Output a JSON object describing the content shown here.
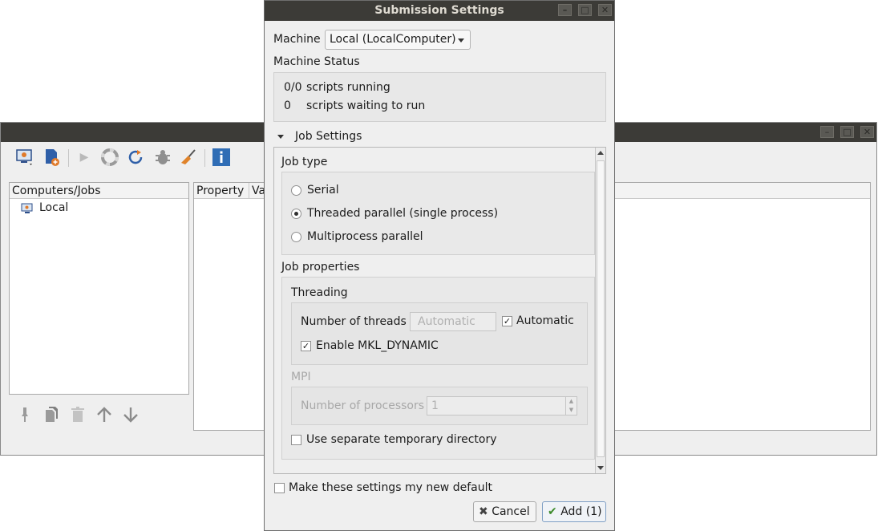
{
  "main_window": {
    "tree_header": "Computers/Jobs",
    "tree_items": [
      {
        "label": "Local",
        "icon": "computer-icon"
      }
    ],
    "properties_header": {
      "property": "Property",
      "value": "Va"
    },
    "toolbar_icons": [
      "computer-menu-icon",
      "add-job-icon",
      "run-icon",
      "lifebuoy-icon",
      "refresh-icon",
      "bug-icon",
      "clean-icon",
      "info-icon"
    ],
    "bottom_icons": [
      "pin-icon",
      "copy-icon",
      "trash-icon",
      "arrow-up-icon",
      "arrow-down-icon"
    ]
  },
  "dialog": {
    "title": "Submission Settings",
    "machine": {
      "label": "Machine",
      "value": "Local (LocalComputer)"
    },
    "machine_status": {
      "title": "Machine Status",
      "rows": [
        {
          "count": "0/0",
          "text": "scripts running"
        },
        {
          "count": "0",
          "text": "scripts waiting to run"
        }
      ]
    },
    "job_settings": {
      "title": "Job Settings"
    },
    "job_type": {
      "title": "Job type",
      "options": [
        {
          "label": "Serial",
          "selected": false
        },
        {
          "label": "Threaded parallel (single process)",
          "selected": true
        },
        {
          "label": "Multiprocess parallel",
          "selected": false
        }
      ]
    },
    "job_properties": {
      "title": "Job properties",
      "threading": {
        "title": "Threading",
        "threads_label": "Number of threads",
        "threads_placeholder": "Automatic",
        "automatic_label": "Automatic",
        "automatic_checked": true,
        "mkl_label": "Enable MKL_DYNAMIC",
        "mkl_checked": true
      },
      "mpi": {
        "title": "MPI",
        "processors_label": "Number of processors",
        "processors_value": "1"
      },
      "temp_dir_label": "Use separate temporary directory",
      "temp_dir_checked": false
    },
    "default_label": "Make these settings my new default",
    "cancel_label": "Cancel",
    "add_label": "Add (1)"
  }
}
